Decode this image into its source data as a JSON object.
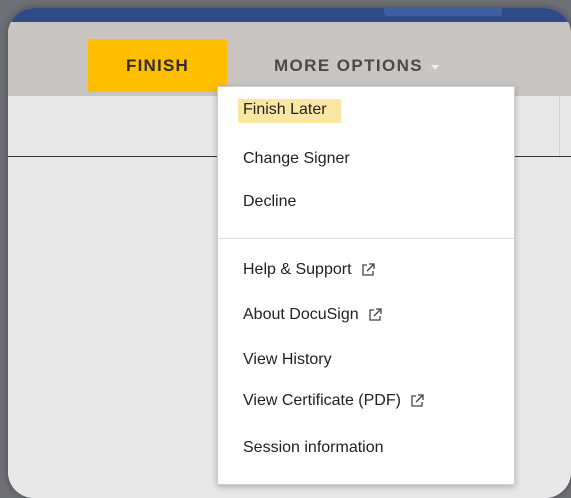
{
  "toolbar": {
    "finish_label": "FINISH",
    "more_options_label": "MORE OPTIONS"
  },
  "menu": {
    "items": [
      {
        "label": "Finish Later",
        "highlighted": true
      },
      {
        "label": "Change Signer"
      },
      {
        "label": "Decline"
      },
      {
        "label": "Help & Support",
        "icon": "external-link-icon"
      },
      {
        "label": "About DocuSign",
        "icon": "external-link-icon"
      },
      {
        "label": "View History"
      },
      {
        "label": "View Certificate (PDF)",
        "icon": "external-link-icon"
      },
      {
        "label": "Session information"
      }
    ]
  },
  "colors": {
    "accent": "#ffbe00",
    "highlight": "#fbe6a2",
    "toolbar_bg": "#c9c5c3",
    "top_bar": "#2f4a86"
  }
}
